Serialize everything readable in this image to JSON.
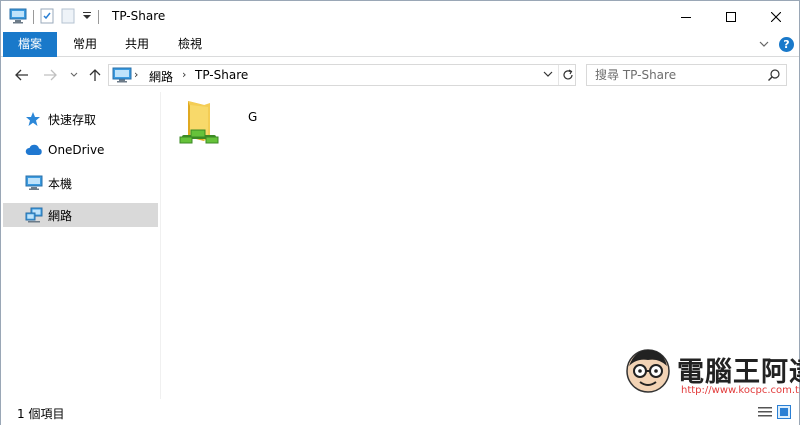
{
  "window": {
    "title": "TP-Share"
  },
  "ribbon": {
    "tabs": [
      {
        "label": "檔案"
      },
      {
        "label": "常用"
      },
      {
        "label": "共用"
      },
      {
        "label": "檢視"
      }
    ],
    "help_label": "?"
  },
  "nav": {
    "breadcrumbs": [
      {
        "label": "網路"
      },
      {
        "label": "TP-Share"
      }
    ],
    "search_placeholder": "搜尋 TP-Share"
  },
  "sidebar": {
    "items": [
      {
        "label": "快速存取",
        "icon": "star-icon"
      },
      {
        "label": "OneDrive",
        "icon": "cloud-icon"
      },
      {
        "label": "本機",
        "icon": "computer-icon"
      },
      {
        "label": "網路",
        "icon": "network-icon",
        "selected": true
      }
    ]
  },
  "content": {
    "items": [
      {
        "label": "G",
        "icon": "network-folder-icon"
      }
    ]
  },
  "status": {
    "item_count": "1 個項目"
  },
  "watermark": {
    "title": "電腦王阿達",
    "url": "http://www.kocpc.com.tw"
  },
  "colors": {
    "accent": "#1979ca",
    "selected_bg": "#d9d9d9"
  }
}
